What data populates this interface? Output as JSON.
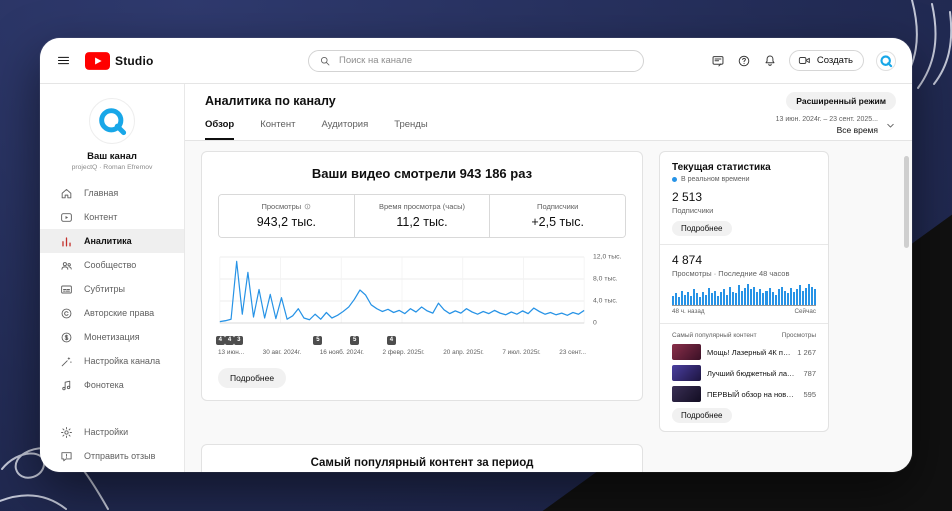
{
  "colors": {
    "accent_blue": "#2793e6",
    "brand_red": "#ff0000",
    "frame_navy": "#232c56",
    "frame_black": "#111111"
  },
  "topbar": {
    "brand": "Studio",
    "search_placeholder": "Поиск на канале",
    "create_label": "Создать"
  },
  "sidebar": {
    "channel_name": "Ваш канал",
    "channel_meta": "projectQ · Roman Efremov",
    "items": [
      {
        "id": "home",
        "icon": "home",
        "label": "Главная"
      },
      {
        "id": "content",
        "icon": "content",
        "label": "Контент"
      },
      {
        "id": "analytics",
        "icon": "analytics",
        "label": "Аналитика",
        "active": true
      },
      {
        "id": "community",
        "icon": "community",
        "label": "Сообщество"
      },
      {
        "id": "subtitles",
        "icon": "subtitles",
        "label": "Субтитры"
      },
      {
        "id": "copyright",
        "icon": "copyright",
        "label": "Авторские права"
      },
      {
        "id": "monetization",
        "icon": "monetization",
        "label": "Монетизация"
      },
      {
        "id": "customization",
        "icon": "customization",
        "label": "Настройка канала"
      },
      {
        "id": "audio-library",
        "icon": "audio",
        "label": "Фонотека"
      }
    ],
    "footer_items": [
      {
        "id": "settings",
        "icon": "settings",
        "label": "Настройки"
      },
      {
        "id": "feedback",
        "icon": "feedback",
        "label": "Отправить отзыв"
      }
    ]
  },
  "main": {
    "title": "Аналитика по каналу",
    "advanced_mode_label": "Расширенный режим",
    "date_range": "13 июн. 2024г. – 23 сент. 2025...",
    "date_preset": "Все время",
    "tabs": [
      {
        "id": "overview",
        "label": "Обзор",
        "active": true
      },
      {
        "id": "content",
        "label": "Контент"
      },
      {
        "id": "audience",
        "label": "Аудитория"
      },
      {
        "id": "trends",
        "label": "Тренды"
      }
    ],
    "headline": "Ваши видео смотрели 943 186 раз",
    "stat_cards": [
      {
        "label": "Просмотры",
        "value": "943,2 тыс.",
        "has_info_icon": true
      },
      {
        "label": "Время просмотра (часы)",
        "value": "11,2 тыс."
      },
      {
        "label": "Подписчики",
        "value": "+2,5 тыс."
      }
    ],
    "chart_markers": [
      {
        "pos": 0.5,
        "label": "4"
      },
      {
        "pos": 3,
        "label": "4"
      },
      {
        "pos": 5.5,
        "label": "3"
      },
      {
        "pos": 27,
        "label": "5"
      },
      {
        "pos": 37,
        "label": "5"
      },
      {
        "pos": 47,
        "label": "4"
      }
    ],
    "details_button": "Подробнее",
    "bottom_heading": "Самый популярный контент за период"
  },
  "realtime": {
    "title": "Текущая статистика",
    "live_label": "В реальном времени",
    "subscribers_value": "2 513",
    "subscribers_label": "Подписчики",
    "details_label": "Подробнее",
    "views_value": "4 874",
    "views_label": "Просмотры · Последние 48 часов",
    "axis_left": "48 ч. назад",
    "axis_right": "Сейчас",
    "list_header_left": "Самый популярный контент",
    "list_header_right": "Просмотры",
    "top_content": [
      {
        "title": "Мощь! Лазерный 4К пр...",
        "views": "1 267",
        "thumb_colors": [
          "#8a2f4a",
          "#3a1026"
        ]
      },
      {
        "title": "Лучший бюджетный лазе...",
        "views": "787",
        "thumb_colors": [
          "#4a3fa0",
          "#1d1440"
        ]
      },
      {
        "title": "ПЕРВЫЙ обзор на новый ...",
        "views": "595",
        "thumb_colors": [
          "#3a2f55",
          "#120d22"
        ]
      }
    ]
  },
  "chart_data": [
    {
      "type": "line",
      "title": "Просмотры за период",
      "ylabel": "Просмотры",
      "ylim": [
        0,
        12000
      ],
      "y_tick_values": [
        12000,
        8000,
        4000,
        0
      ],
      "y_ticks": [
        "12,0 тыс.",
        "8,0 тыс.",
        "4,0 тыс.",
        "0"
      ],
      "x_ticks": [
        "13 июн...",
        "30 авг. 2024г.",
        "16 нояб. 2024г.",
        "2 февр. 2025г.",
        "20 апр. 2025г.",
        "7 июл. 2025г.",
        "23 сент..."
      ],
      "series": [
        {
          "name": "Просмотры",
          "values": [
            250,
            420,
            700,
            11200,
            1600,
            9200,
            1100,
            6100,
            900,
            5200,
            800,
            4600,
            700,
            1300,
            2600,
            900,
            600,
            1600,
            700,
            1900,
            900,
            1400,
            2100,
            2900,
            4300,
            6000,
            5100,
            3300,
            2600,
            2100,
            2500,
            1900,
            2300,
            1700,
            2600,
            2000,
            2900,
            2200,
            1800,
            3600,
            2400,
            1700,
            2200,
            1800,
            2600,
            2000,
            1600,
            2100,
            1700,
            2300,
            1800,
            1500,
            2000,
            1600,
            2200,
            1700,
            2700,
            2100,
            1600,
            1900,
            1500,
            1800,
            1400,
            1900,
            1600,
            2300
          ]
        }
      ]
    },
    {
      "type": "bar",
      "title": "Просмотры · Последние 48 часов",
      "values": [
        70,
        90,
        60,
        110,
        80,
        100,
        70,
        120,
        90,
        60,
        100,
        80,
        130,
        90,
        110,
        70,
        100,
        120,
        80,
        140,
        100,
        90,
        150,
        110,
        130,
        160,
        120,
        140,
        100,
        120,
        90,
        110,
        130,
        100,
        80,
        120,
        140,
        110,
        90,
        130,
        100,
        120,
        150,
        110,
        130,
        160,
        140,
        120
      ]
    }
  ]
}
